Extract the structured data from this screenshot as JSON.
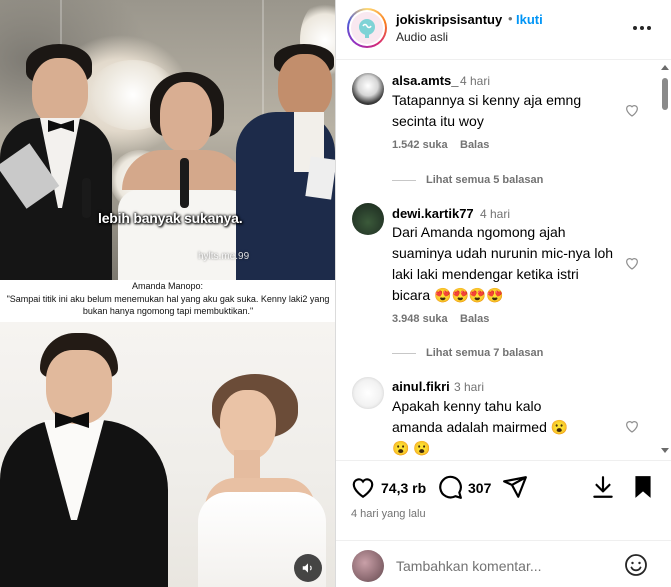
{
  "media": {
    "overlay_caption": "lebih banyak sukanya.",
    "watermark": "hylts.me.99",
    "quote_name": "Amanda Manopo:",
    "quote_text": "\"Sampai titik ini aku belum menemukan hal yang aku gak suka. Kenny laki2 yang bukan hanya ngomong tapi membuktikan.\""
  },
  "header": {
    "username": "jokiskripsisantuy",
    "separator": "•",
    "follow_label": "Ikuti",
    "audio_label": "Audio asli"
  },
  "comments": [
    {
      "user": "alsa.amts_",
      "time": "4 hari",
      "text": "Tatapannya si kenny aja emng secinta itu woy",
      "likes": "1.542 suka",
      "reply_label": "Balas",
      "view_replies": "Lihat semua 5 balasan"
    },
    {
      "user": "dewi.kartik77",
      "time": "4 hari",
      "text": "Dari Amanda ngomong ajah suaminya udah nurunin mic-nya loh laki laki mendengar ketika istri bicara 😍😍😍😍",
      "likes": "3.948 suka",
      "reply_label": "Balas",
      "view_replies": "Lihat semua 7 balasan"
    },
    {
      "user": "ainul.fikri",
      "time": "3 hari",
      "text": "Apakah kenny tahu kalo amanda adalah mairmed 😮😮 😮"
    }
  ],
  "actions": {
    "likes_count": "74,3 rb",
    "comments_count": "307",
    "date": "4 hari yang lalu"
  },
  "add_comment": {
    "placeholder": "Tambahkan komentar..."
  },
  "colors": {
    "accent": "#0095f6",
    "secondary_text": "#737373"
  }
}
